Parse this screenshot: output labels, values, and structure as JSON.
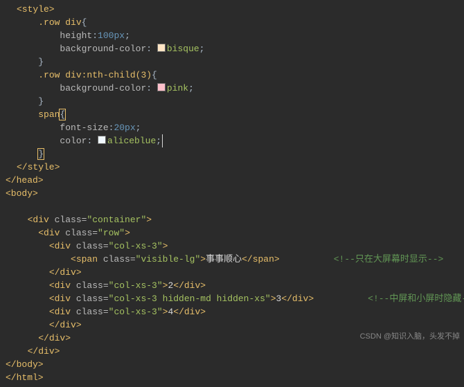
{
  "css": {
    "open_style": "<style>",
    "sel1": ".row div",
    "rule1a_prop": "height",
    "rule1a_val": "100px",
    "rule1b_prop": "background-color",
    "rule1b_color": "bisque",
    "sel2": ".row div:nth-child(3)",
    "rule2a_prop": "background-color",
    "rule2a_color": "pink",
    "sel3": "span",
    "rule3a_prop": "font-size",
    "rule3a_val": "20px",
    "rule3b_prop": "color",
    "rule3b_color": "aliceblue",
    "close_style": "</style>",
    "close_head": "</head>",
    "open_body": "<body>"
  },
  "html": {
    "container_open": "<div class=\"container\">",
    "row_open": "<div class=\"row\">",
    "col1_open": "<div class=\"col-xs-3\">",
    "span_open": "<span class=\"visible-lg\">",
    "span_text": "事事顺心",
    "span_close": "</span>",
    "comment1": "<!--只在大屏幕时显示-->",
    "div_close": "</div>",
    "col2": "<div class=\"col-xs-3\">2</div>",
    "col3": "<div class=\"col-xs-3 hidden-md hidden-xs\">3</div>",
    "comment2": "<!--中屏和小屏时隐藏-->",
    "col4": "<div class=\"col-xs-3\">4</div>",
    "close_body": "</body>",
    "close_html": "</html>"
  },
  "watermark": "CSDN @知识入脑，头发不掉"
}
